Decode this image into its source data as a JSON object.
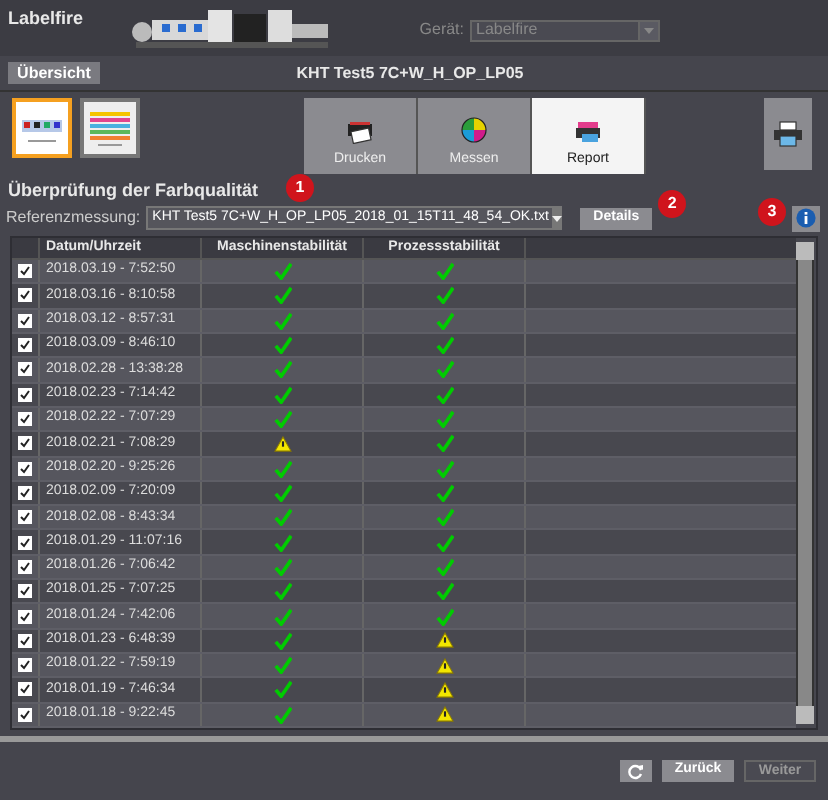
{
  "app_title": "Labelfire",
  "device": {
    "label": "Gerät:",
    "value": "Labelfire",
    "disabled": true
  },
  "overview_button": "Übersicht",
  "job_title": "KHT Test5 7C+W_H_OP_LP05",
  "thumbnails": [
    {
      "selected": true
    },
    {
      "selected": false
    }
  ],
  "steps": [
    {
      "label": "Drucken",
      "selected": false
    },
    {
      "label": "Messen",
      "selected": false
    },
    {
      "label": "Report",
      "selected": true
    }
  ],
  "heading": "Überprüfung der Farbqualität",
  "reference": {
    "label": "Referenzmessung:",
    "value": "KHT Test5 7C+W_H_OP_LP05_2018_01_15T11_48_54_OK.txt"
  },
  "details_button": "Details",
  "badges": [
    "1",
    "2",
    "3"
  ],
  "table": {
    "columns": [
      "Datum/Uhrzeit",
      "Maschinenstabilität",
      "Prozessstabilität"
    ],
    "rows": [
      {
        "checked": true,
        "date": "2018.03.19 - 7:52:50",
        "machine_ok": true,
        "process_ok": true
      },
      {
        "checked": true,
        "date": "2018.03.16 - 8:10:58",
        "machine_ok": true,
        "process_ok": true
      },
      {
        "checked": true,
        "date": "2018.03.12 - 8:57:31",
        "machine_ok": true,
        "process_ok": true
      },
      {
        "checked": true,
        "date": "2018.03.09 - 8:46:10",
        "machine_ok": true,
        "process_ok": true
      },
      {
        "checked": true,
        "date": "2018.02.28 - 13:38:28",
        "machine_ok": true,
        "process_ok": true
      },
      {
        "checked": true,
        "date": "2018.02.23 - 7:14:42",
        "machine_ok": true,
        "process_ok": true
      },
      {
        "checked": true,
        "date": "2018.02.22 - 7:07:29",
        "machine_ok": true,
        "process_ok": true
      },
      {
        "checked": true,
        "date": "2018.02.21 - 7:08:29",
        "machine_ok": false,
        "process_ok": true
      },
      {
        "checked": true,
        "date": "2018.02.20 - 9:25:26",
        "machine_ok": true,
        "process_ok": true
      },
      {
        "checked": true,
        "date": "2018.02.09 - 7:20:09",
        "machine_ok": true,
        "process_ok": true
      },
      {
        "checked": true,
        "date": "2018.02.08 - 8:43:34",
        "machine_ok": true,
        "process_ok": true
      },
      {
        "checked": true,
        "date": "2018.01.29 - 11:07:16",
        "machine_ok": true,
        "process_ok": true
      },
      {
        "checked": true,
        "date": "2018.01.26 - 7:06:42",
        "machine_ok": true,
        "process_ok": true
      },
      {
        "checked": true,
        "date": "2018.01.25 - 7:07:25",
        "machine_ok": true,
        "process_ok": true
      },
      {
        "checked": true,
        "date": "2018.01.24 - 7:42:06",
        "machine_ok": true,
        "process_ok": true
      },
      {
        "checked": true,
        "date": "2018.01.23 - 6:48:39",
        "machine_ok": true,
        "process_ok": false
      },
      {
        "checked": true,
        "date": "2018.01.22 - 7:59:19",
        "machine_ok": true,
        "process_ok": false
      },
      {
        "checked": true,
        "date": "2018.01.19 - 7:46:34",
        "machine_ok": true,
        "process_ok": false
      },
      {
        "checked": true,
        "date": "2018.01.18 - 9:22:45",
        "machine_ok": true,
        "process_ok": false
      }
    ]
  },
  "footer_buttons": [
    {
      "kind": "refresh",
      "disabled": false
    },
    {
      "kind": "text",
      "label": "Zurück",
      "disabled": false
    },
    {
      "kind": "text",
      "label": "Weiter",
      "disabled": true
    }
  ]
}
